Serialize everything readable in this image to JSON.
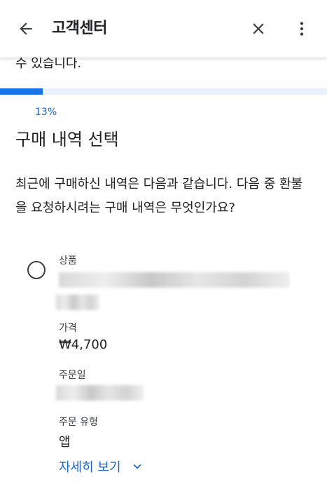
{
  "appbar": {
    "title": "고객센터",
    "back_icon": "arrow-left-icon",
    "close_icon": "close-icon",
    "more_icon": "more-vert-icon"
  },
  "clipped_text": "수 있습니다.",
  "progress": {
    "label": "13%",
    "value": 0.13
  },
  "heading": "구매 내역 선택",
  "question": "최근에 구매하신 내역은 다음과 같습니다. 다음 중 환불을 요청하시려는 구매 내역은 무엇인가요?",
  "item": {
    "product_label": "상품",
    "price_label": "가격",
    "price_value": "₩4,700",
    "order_date_label": "주문일",
    "order_type_label": "주문 유형",
    "order_type_value": "앱"
  },
  "details_link": "자세히 보기",
  "colors": {
    "accent": "#1a73e8",
    "link": "#1967d2",
    "track": "#e8f0fe"
  }
}
